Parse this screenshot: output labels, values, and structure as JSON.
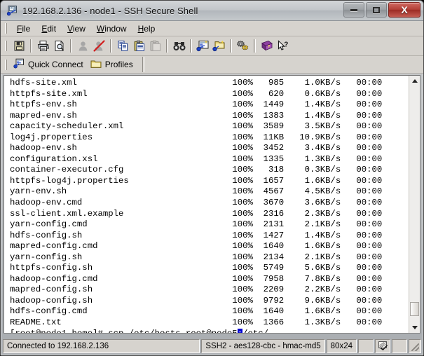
{
  "window": {
    "title": "192.168.2.136 - node1 - SSH Secure Shell",
    "icon": "ssh-app-icon",
    "buttons": {
      "minimize": "minimize",
      "maximize": "maximize",
      "close": "X"
    }
  },
  "menubar": {
    "items": [
      {
        "label": "File",
        "accel": "F"
      },
      {
        "label": "Edit",
        "accel": "E"
      },
      {
        "label": "View",
        "accel": "V"
      },
      {
        "label": "Window",
        "accel": "W"
      },
      {
        "label": "Help",
        "accel": "H"
      }
    ]
  },
  "toolbar": {
    "groups": [
      [
        "save-icon"
      ],
      [
        "print-icon",
        "print-preview-icon"
      ],
      [
        "connect-icon",
        "disconnect-icon"
      ],
      [
        "copy-icon",
        "paste-icon",
        "paste-disabled-icon"
      ],
      [
        "find-icon"
      ],
      [
        "new-terminal-icon",
        "new-file-transfer-icon"
      ],
      [
        "settings-icon"
      ],
      [
        "help-book-icon",
        "context-help-icon"
      ]
    ]
  },
  "quickbar": {
    "quick_connect": "Quick Connect",
    "profiles": "Profiles"
  },
  "terminal": {
    "columns": [
      "file",
      "percent",
      "size",
      "speed",
      "time"
    ],
    "rows": [
      {
        "file": "hdfs-site.xml",
        "percent": "100%",
        "size": "985",
        "speed": "1.0KB/s",
        "time": "00:00"
      },
      {
        "file": "httpfs-site.xml",
        "percent": "100%",
        "size": "620",
        "speed": "0.6KB/s",
        "time": "00:00"
      },
      {
        "file": "httpfs-env.sh",
        "percent": "100%",
        "size": "1449",
        "speed": "1.4KB/s",
        "time": "00:00"
      },
      {
        "file": "mapred-env.sh",
        "percent": "100%",
        "size": "1383",
        "speed": "1.4KB/s",
        "time": "00:00"
      },
      {
        "file": "capacity-scheduler.xml",
        "percent": "100%",
        "size": "3589",
        "speed": "3.5KB/s",
        "time": "00:00"
      },
      {
        "file": "log4j.properties",
        "percent": "100%",
        "size": "11KB",
        "speed": "10.9KB/s",
        "time": "00:00"
      },
      {
        "file": "hadoop-env.sh",
        "percent": "100%",
        "size": "3452",
        "speed": "3.4KB/s",
        "time": "00:00"
      },
      {
        "file": "configuration.xsl",
        "percent": "100%",
        "size": "1335",
        "speed": "1.3KB/s",
        "time": "00:00"
      },
      {
        "file": "container-executor.cfg",
        "percent": "100%",
        "size": "318",
        "speed": "0.3KB/s",
        "time": "00:00"
      },
      {
        "file": "httpfs-log4j.properties",
        "percent": "100%",
        "size": "1657",
        "speed": "1.6KB/s",
        "time": "00:00"
      },
      {
        "file": "yarn-env.sh",
        "percent": "100%",
        "size": "4567",
        "speed": "4.5KB/s",
        "time": "00:00"
      },
      {
        "file": "hadoop-env.cmd",
        "percent": "100%",
        "size": "3670",
        "speed": "3.6KB/s",
        "time": "00:00"
      },
      {
        "file": "ssl-client.xml.example",
        "percent": "100%",
        "size": "2316",
        "speed": "2.3KB/s",
        "time": "00:00"
      },
      {
        "file": "yarn-config.cmd",
        "percent": "100%",
        "size": "2131",
        "speed": "2.1KB/s",
        "time": "00:00"
      },
      {
        "file": "hdfs-config.sh",
        "percent": "100%",
        "size": "1427",
        "speed": "1.4KB/s",
        "time": "00:00"
      },
      {
        "file": "mapred-config.cmd",
        "percent": "100%",
        "size": "1640",
        "speed": "1.6KB/s",
        "time": "00:00"
      },
      {
        "file": "yarn-config.sh",
        "percent": "100%",
        "size": "2134",
        "speed": "2.1KB/s",
        "time": "00:00"
      },
      {
        "file": "httpfs-config.sh",
        "percent": "100%",
        "size": "5749",
        "speed": "5.6KB/s",
        "time": "00:00"
      },
      {
        "file": "hadoop-config.cmd",
        "percent": "100%",
        "size": "7958",
        "speed": "7.8KB/s",
        "time": "00:00"
      },
      {
        "file": "mapred-config.sh",
        "percent": "100%",
        "size": "2209",
        "speed": "2.2KB/s",
        "time": "00:00"
      },
      {
        "file": "hadoop-config.sh",
        "percent": "100%",
        "size": "9792",
        "speed": "9.6KB/s",
        "time": "00:00"
      },
      {
        "file": "hdfs-config.cmd",
        "percent": "100%",
        "size": "1640",
        "speed": "1.6KB/s",
        "time": "00:00"
      },
      {
        "file": "README.txt",
        "percent": "100%",
        "size": "1366",
        "speed": "1.3KB/s",
        "time": "00:00"
      }
    ],
    "prompt_before": "[root@node1 home]# scp /etc/hosts root@node5",
    "cursor_char": ":",
    "prompt_after": "/etc/",
    "cursor_color": "#0000d0",
    "background": "#ffffff",
    "foreground": "#000000"
  },
  "statusbar": {
    "connection": "Connected to 192.168.2.136",
    "cipher": "SSH2 - aes128-cbc - hmac-md5",
    "size": "80x24",
    "icons": [
      "blank-cell",
      "encryption-icon",
      "blank-cell-2"
    ]
  }
}
